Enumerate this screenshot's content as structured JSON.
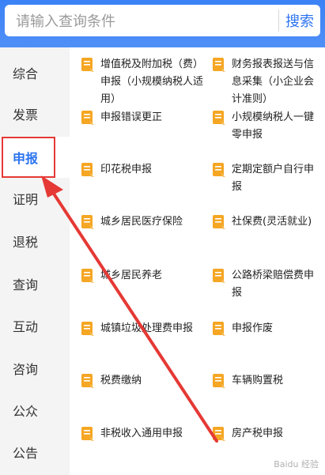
{
  "search": {
    "placeholder": "请输入查询条件",
    "button_label": "搜索"
  },
  "sidebar": {
    "items": [
      {
        "label": "综合"
      },
      {
        "label": "发票"
      },
      {
        "label": "申报",
        "active": true
      },
      {
        "label": "证明"
      },
      {
        "label": "退税"
      },
      {
        "label": "查询"
      },
      {
        "label": "互动"
      },
      {
        "label": "咨询"
      },
      {
        "label": "公众"
      },
      {
        "label": "公告"
      }
    ]
  },
  "content": {
    "tiles": [
      {
        "label": "增值税及附加税（费）申报（小规模纳税人适用）",
        "icon": "document-icon"
      },
      {
        "label": "财务报表报送与信息采集（小企业会计准则）",
        "icon": "document-icon"
      },
      {
        "label": "申报错误更正",
        "icon": "document-icon"
      },
      {
        "label": "小规模纳税人一键零申报",
        "icon": "document-icon"
      },
      {
        "label": "印花税申报",
        "icon": "document-icon"
      },
      {
        "label": "定期定额户自行申报",
        "icon": "document-icon"
      },
      {
        "label": "城乡居民医疗保险",
        "icon": "document-icon"
      },
      {
        "label": "社保费(灵活就业)",
        "icon": "document-icon"
      },
      {
        "label": "城乡居民养老",
        "icon": "document-icon"
      },
      {
        "label": "公路桥梁赔偿费申报",
        "icon": "document-icon"
      },
      {
        "label": "城镇垃圾处理费申报",
        "icon": "document-icon"
      },
      {
        "label": "申报作废",
        "icon": "document-icon"
      },
      {
        "label": "税费缴纳",
        "icon": "document-icon"
      },
      {
        "label": "车辆购置税",
        "icon": "document-icon"
      },
      {
        "label": "非税收入通用申报",
        "icon": "document-icon"
      },
      {
        "label": "房产税申报",
        "icon": "document-icon"
      }
    ]
  },
  "colors": {
    "accent": "#2d74f0",
    "highlight": "#e53935",
    "icon": "#f5a623"
  },
  "watermark": "Baidu 经验"
}
